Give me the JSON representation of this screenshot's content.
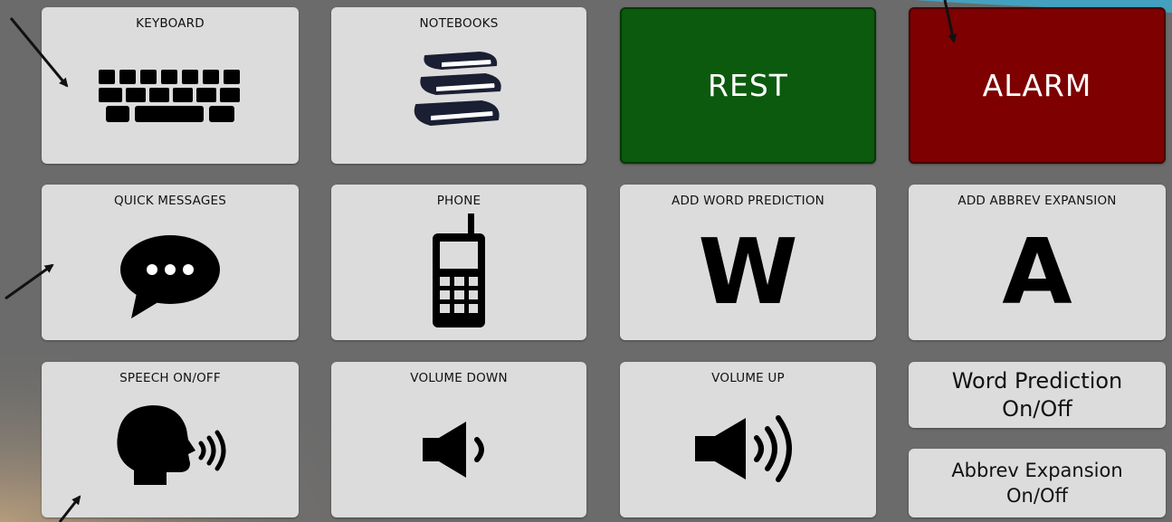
{
  "buttons": {
    "keyboard": "KEYBOARD",
    "notebooks": "NOTEBOOKS",
    "rest": "REST",
    "alarm": "ALARM",
    "quick_messages": "QUICK MESSAGES",
    "phone": "PHONE",
    "add_word_prediction": "ADD WORD PREDICTION",
    "add_word_prediction_letter": "W",
    "add_abbrev_expansion": "ADD ABBREV EXPANSION",
    "add_abbrev_expansion_letter": "A",
    "speech_on_off": "SPEECH ON/OFF",
    "volume_down": "VOLUME DOWN",
    "volume_up": "VOLUME UP",
    "word_prediction_toggle": {
      "line1": "Word Prediction",
      "line2": "On/Off"
    },
    "abbrev_expansion_toggle": {
      "line1": "Abbrev Expansion",
      "line2": "On/Off"
    }
  },
  "icons": {
    "keyboard": "keyboard-icon",
    "notebooks": "books-icon",
    "quick_messages": "speech-bubble-icon",
    "phone": "cell-phone-icon",
    "speech": "speaking-head-icon",
    "volume_down": "speaker-low-icon",
    "volume_up": "speaker-high-icon"
  },
  "colors": {
    "background": "#6b6b6b",
    "tile": "#dcdcdc",
    "rest": "#0c5a0d",
    "alarm": "#7e0000",
    "accent_top_right": "#3fa7c9"
  }
}
